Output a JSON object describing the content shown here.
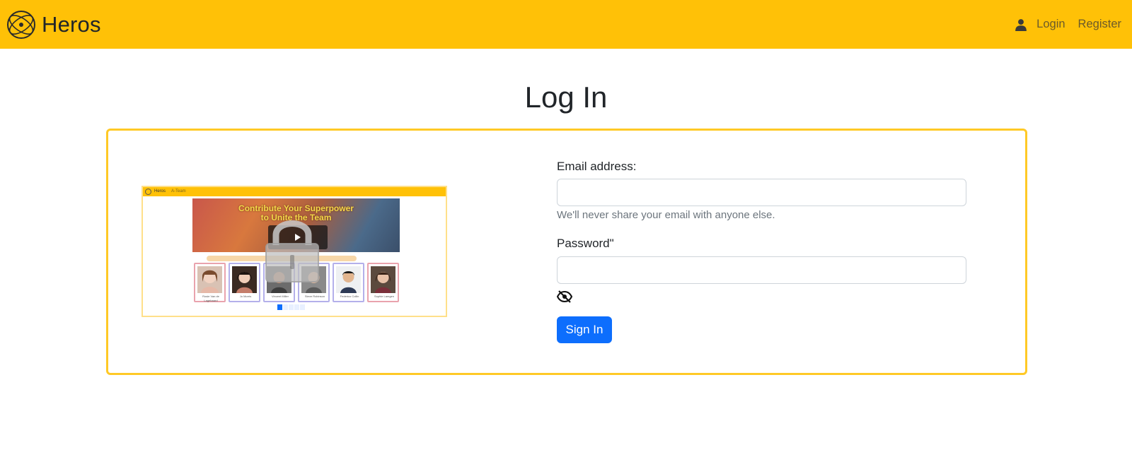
{
  "navbar": {
    "brand": "Heros",
    "logo_icon": "atom-globe-icon",
    "user_icon": "user-icon",
    "login_label": "Login",
    "register_label": "Register",
    "background_color": "#ffc107"
  },
  "page": {
    "title": "Log In"
  },
  "preview": {
    "brand": "Heros",
    "team": "A-Team",
    "banner_line1": "Contribute Your Superpower",
    "banner_line2": "to Unite the Team",
    "overlay_icon": "lock-icon",
    "cards": [
      {
        "name": "Rosie Van de Lagebaard",
        "border": "pink"
      },
      {
        "name": "Jo Morris",
        "border": "blue"
      },
      {
        "name": "Vincent Miller",
        "border": "blue"
      },
      {
        "name": "Steve Robinson",
        "border": "blue"
      },
      {
        "name": "Federico Collin",
        "border": "blue"
      },
      {
        "name": "Sophie Lamgen",
        "border": "pink"
      }
    ]
  },
  "form": {
    "email_label": "Email address:",
    "email_value": "",
    "email_help": "We'll never share your email with anyone else.",
    "password_label": "Password\"",
    "password_value": "",
    "toggle_icon": "eye-slash-icon",
    "submit_label": "Sign In",
    "accent_color": "#0d6efd",
    "card_border_color": "#ffc926"
  }
}
